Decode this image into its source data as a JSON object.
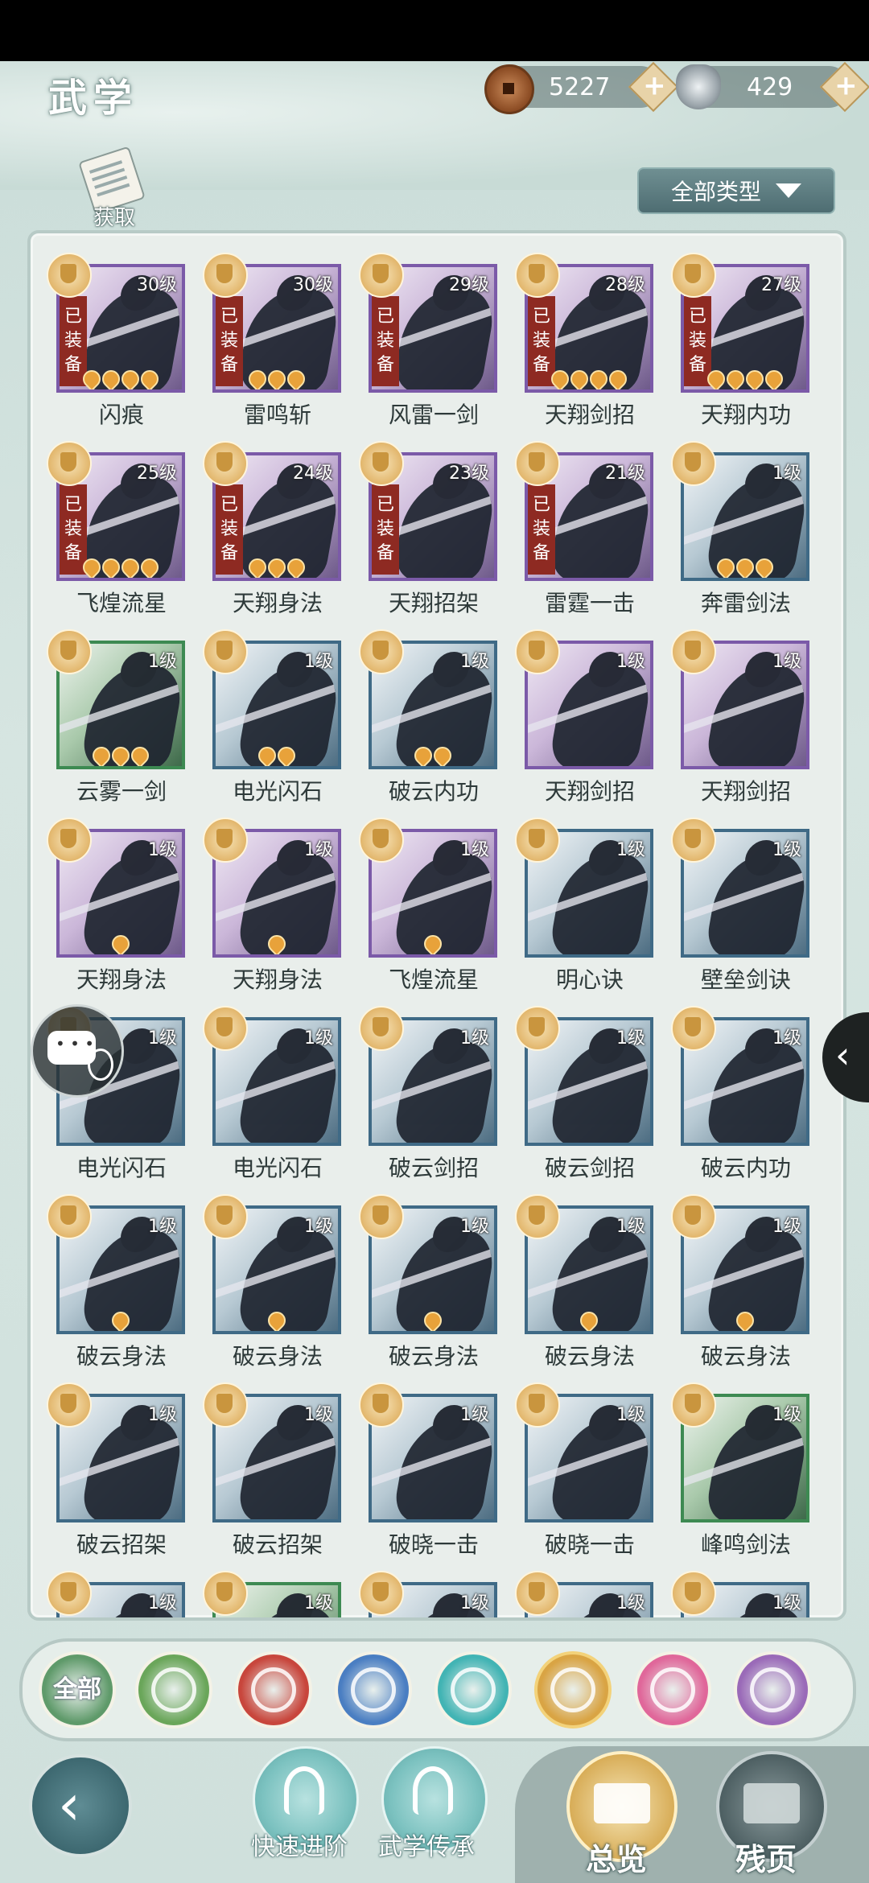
{
  "header": {
    "title": "武学"
  },
  "currency": {
    "copper": {
      "icon": "copper-coin-icon",
      "value": "5227",
      "add": "+"
    },
    "silver": {
      "icon": "silver-ingot-icon",
      "value": "429",
      "add": "+"
    }
  },
  "acquire": {
    "label": "获取"
  },
  "filter": {
    "label": "全部类型"
  },
  "equipped_label": [
    "已",
    "装",
    "备"
  ],
  "skills": [
    {
      "name": "闪痕",
      "level": "30级",
      "equipped": true,
      "rarity": "purple",
      "stars": 4
    },
    {
      "name": "雷鸣斩",
      "level": "30级",
      "equipped": true,
      "rarity": "purple",
      "stars": 3
    },
    {
      "name": "风雷一剑",
      "level": "29级",
      "equipped": true,
      "rarity": "purple",
      "stars": 0
    },
    {
      "name": "天翔剑招",
      "level": "28级",
      "equipped": true,
      "rarity": "purple",
      "stars": 4
    },
    {
      "name": "天翔内功",
      "level": "27级",
      "equipped": true,
      "rarity": "purple",
      "stars": 4
    },
    {
      "name": "飞煌流星",
      "level": "25级",
      "equipped": true,
      "rarity": "purple",
      "stars": 4
    },
    {
      "name": "天翔身法",
      "level": "24级",
      "equipped": true,
      "rarity": "purple",
      "stars": 3
    },
    {
      "name": "天翔招架",
      "level": "23级",
      "equipped": true,
      "rarity": "purple",
      "stars": 0
    },
    {
      "name": "雷霆一击",
      "level": "21级",
      "equipped": true,
      "rarity": "purple",
      "stars": 0
    },
    {
      "name": "奔雷剑法",
      "level": "1级",
      "equipped": false,
      "rarity": "blue",
      "stars": 3
    },
    {
      "name": "云雾一剑",
      "level": "1级",
      "equipped": false,
      "rarity": "green",
      "stars": 3
    },
    {
      "name": "电光闪石",
      "level": "1级",
      "equipped": false,
      "rarity": "blue",
      "stars": 2
    },
    {
      "name": "破云内功",
      "level": "1级",
      "equipped": false,
      "rarity": "blue",
      "stars": 2
    },
    {
      "name": "天翔剑招",
      "level": "1级",
      "equipped": false,
      "rarity": "purple",
      "stars": 0
    },
    {
      "name": "天翔剑招",
      "level": "1级",
      "equipped": false,
      "rarity": "purple",
      "stars": 0
    },
    {
      "name": "天翔身法",
      "level": "1级",
      "equipped": false,
      "rarity": "purple",
      "stars": 1
    },
    {
      "name": "天翔身法",
      "level": "1级",
      "equipped": false,
      "rarity": "purple",
      "stars": 1
    },
    {
      "name": "飞煌流星",
      "level": "1级",
      "equipped": false,
      "rarity": "purple",
      "stars": 1
    },
    {
      "name": "明心诀",
      "level": "1级",
      "equipped": false,
      "rarity": "blue",
      "stars": 0
    },
    {
      "name": "壁垒剑诀",
      "level": "1级",
      "equipped": false,
      "rarity": "blue",
      "stars": 0
    },
    {
      "name": "电光闪石",
      "level": "1级",
      "equipped": false,
      "rarity": "blue",
      "stars": 0
    },
    {
      "name": "电光闪石",
      "level": "1级",
      "equipped": false,
      "rarity": "blue",
      "stars": 0
    },
    {
      "name": "破云剑招",
      "level": "1级",
      "equipped": false,
      "rarity": "blue",
      "stars": 0
    },
    {
      "name": "破云剑招",
      "level": "1级",
      "equipped": false,
      "rarity": "blue",
      "stars": 0
    },
    {
      "name": "破云内功",
      "level": "1级",
      "equipped": false,
      "rarity": "blue",
      "stars": 0
    },
    {
      "name": "破云身法",
      "level": "1级",
      "equipped": false,
      "rarity": "blue",
      "stars": 1
    },
    {
      "name": "破云身法",
      "level": "1级",
      "equipped": false,
      "rarity": "blue",
      "stars": 1
    },
    {
      "name": "破云身法",
      "level": "1级",
      "equipped": false,
      "rarity": "blue",
      "stars": 1
    },
    {
      "name": "破云身法",
      "level": "1级",
      "equipped": false,
      "rarity": "blue",
      "stars": 1
    },
    {
      "name": "破云身法",
      "level": "1级",
      "equipped": false,
      "rarity": "blue",
      "stars": 1
    },
    {
      "name": "破云招架",
      "level": "1级",
      "equipped": false,
      "rarity": "blue",
      "stars": 0
    },
    {
      "name": "破云招架",
      "level": "1级",
      "equipped": false,
      "rarity": "blue",
      "stars": 0
    },
    {
      "name": "破晓一击",
      "level": "1级",
      "equipped": false,
      "rarity": "blue",
      "stars": 0
    },
    {
      "name": "破晓一击",
      "level": "1级",
      "equipped": false,
      "rarity": "blue",
      "stars": 0
    },
    {
      "name": "峰鸣剑法",
      "level": "1级",
      "equipped": false,
      "rarity": "green",
      "stars": 0
    },
    {
      "name": "",
      "level": "1级",
      "equipped": false,
      "rarity": "blue",
      "stars": 0
    },
    {
      "name": "",
      "level": "1级",
      "equipped": false,
      "rarity": "green",
      "stars": 0
    },
    {
      "name": "",
      "level": "1级",
      "equipped": false,
      "rarity": "blue",
      "stars": 0
    },
    {
      "name": "",
      "level": "1级",
      "equipped": false,
      "rarity": "blue",
      "stars": 0
    },
    {
      "name": "",
      "level": "1级",
      "equipped": false,
      "rarity": "blue",
      "stars": 0
    }
  ],
  "categories": [
    {
      "label": "全部",
      "icon": "all-icon",
      "color": "#5f9a6a"
    },
    {
      "label": "",
      "icon": "sword-icon",
      "color": "#6aa65a"
    },
    {
      "label": "",
      "icon": "flame-icon",
      "color": "#c8463c"
    },
    {
      "label": "",
      "icon": "wave-icon",
      "color": "#4a7ec2"
    },
    {
      "label": "",
      "icon": "butterfly-icon",
      "color": "#42b4b4"
    },
    {
      "label": "",
      "icon": "shield-icon",
      "color": "#d9a444"
    },
    {
      "label": "",
      "icon": "moon-icon",
      "color": "#e0679a"
    },
    {
      "label": "",
      "icon": "rose-icon",
      "color": "#9a6ab8"
    }
  ],
  "bottom": {
    "back_icon": "back-arrow-icon",
    "fast_advance": "快速进阶",
    "inherit": "武学传承",
    "overview": "总览",
    "remnant": "残页"
  }
}
